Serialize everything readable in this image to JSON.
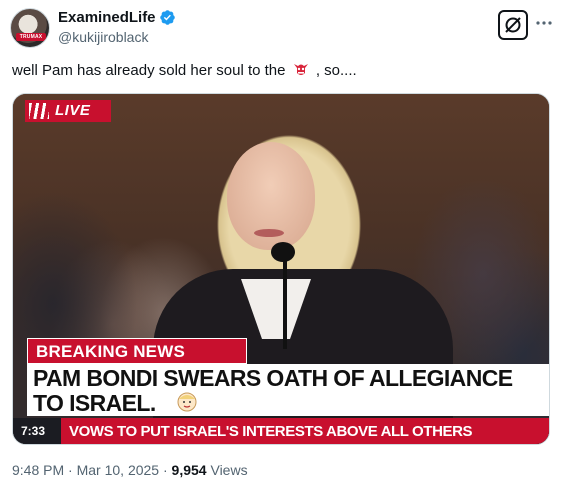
{
  "author": {
    "display_name": "ExaminedLife",
    "handle": "@kukijiroblack",
    "avatar_badge": "TRUMAX"
  },
  "tweet": {
    "text_before": "well Pam has already sold her soul to the",
    "text_after": ", so....",
    "emoji": "goblin-emoji"
  },
  "media": {
    "live_label": "LIVE",
    "breaking_label": "BREAKING NEWS",
    "headline_line1": "PAM BONDI SWEARS OATH OF ALLEGIANCE",
    "headline_line2": "TO ISRAEL.",
    "ticker_time": "7:33",
    "ticker_text": "VOWS TO PUT ISRAEL'S INTERESTS ABOVE ALL OTHERS"
  },
  "meta": {
    "time": "9:48 PM",
    "separator": "·",
    "date": "Mar 10, 2025",
    "views_count": "9,954",
    "views_label": "Views"
  },
  "colors": {
    "verified": "#1d9bf0",
    "news_red": "#c8102e",
    "secondary_text": "#536471"
  }
}
